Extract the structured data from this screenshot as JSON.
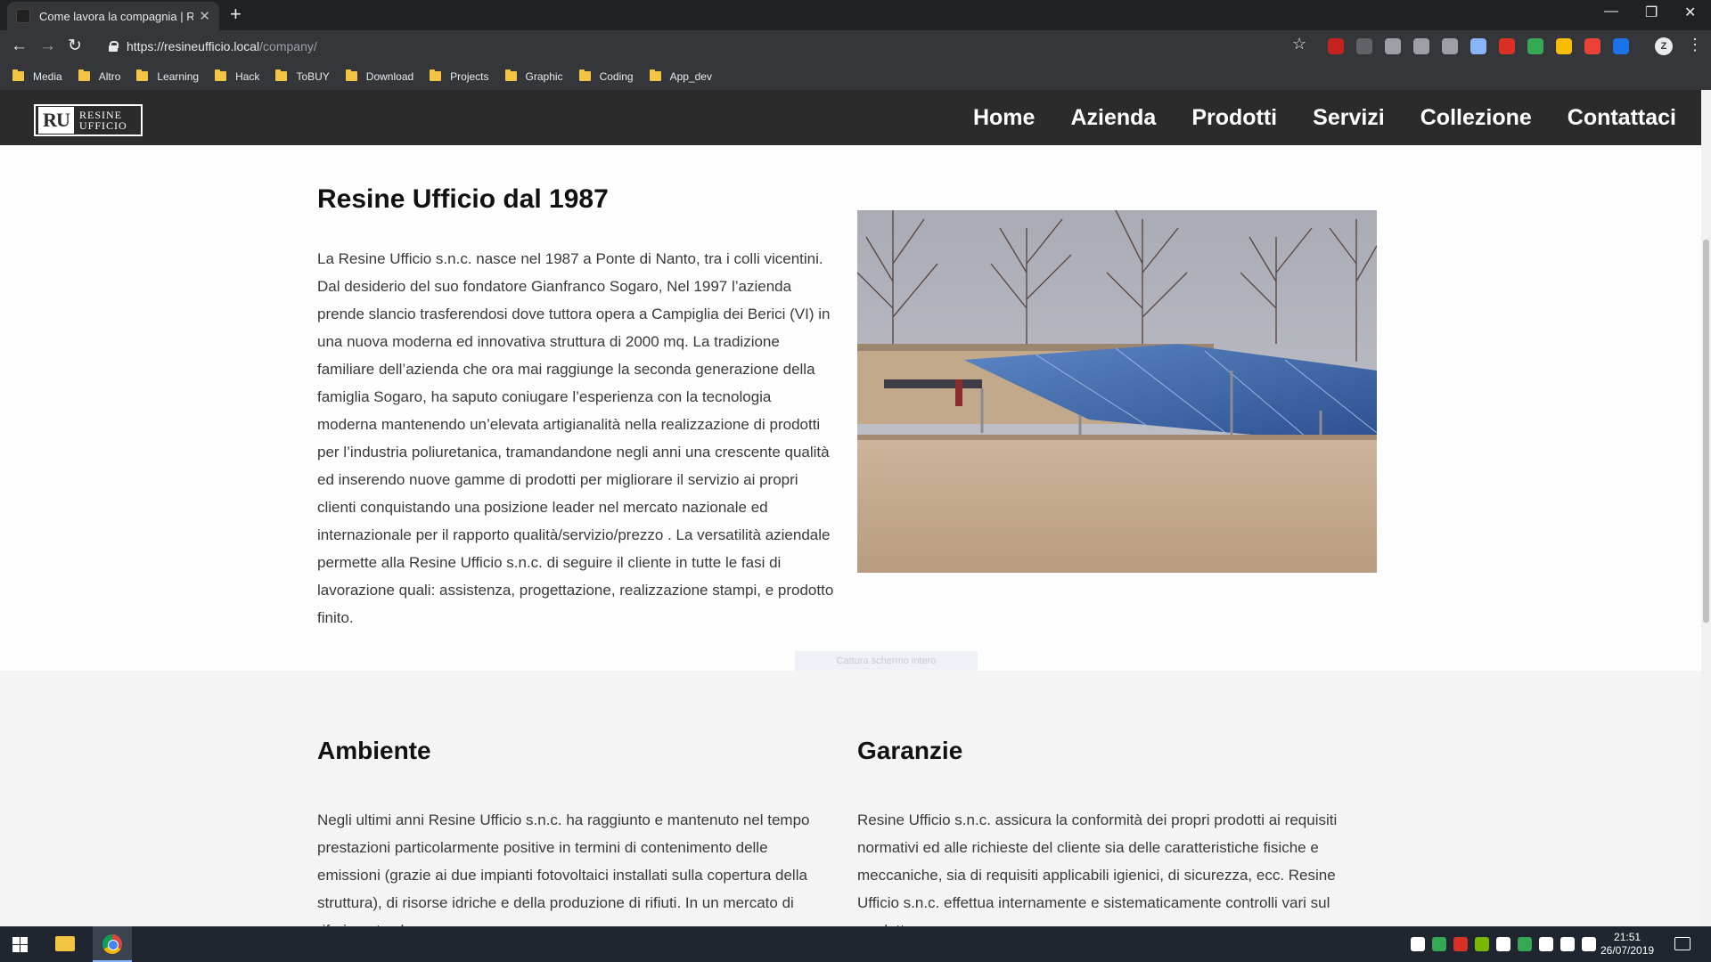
{
  "browser": {
    "tab_title": "Come lavora la compagnia | Resi",
    "tab_close": "✕",
    "new_tab": "+",
    "url_host": "https://resineufficio.local",
    "url_path": "/company/",
    "bookmarks": [
      "Media",
      "Altro",
      "Learning",
      "Hack",
      "ToBUY",
      "Download",
      "Projects",
      "Graphic",
      "Coding",
      "App_dev"
    ],
    "profile_initial": "Z",
    "extension_colors": [
      "#c5221f",
      "#5f6368",
      "#9aa0a6",
      "#9aa0a6",
      "#9aa0a6",
      "#8ab4f8",
      "#d93025",
      "#34a853",
      "#fbbc04",
      "#ea4335",
      "#1a73e8"
    ]
  },
  "site": {
    "logo_mark": "RU",
    "logo_text_line1": "RESINE",
    "logo_text_line2": "UFFICIO",
    "nav": [
      "Home",
      "Azienda",
      "Prodotti",
      "Servizi",
      "Collezione",
      "Contattaci"
    ]
  },
  "content": {
    "title": "Resine Ufficio dal 1987",
    "intro": "La Resine Ufficio s.n.c. nasce nel 1987 a Ponte di Nanto, tra i colli vicentini. Dal desiderio del suo fondatore Gianfranco Sogaro, Nel 1997 l’azienda prende slancio trasferendosi dove tuttora opera a Campiglia dei Berici (VI) in una nuova moderna ed innovativa struttura di 2000 mq. La tradizione familiare dell’azienda che ora mai raggiunge la seconda generazione della famiglia Sogaro, ha saputo coniugare l’esperienza con la tecnologia moderna mantenendo un’elevata artigianalità nella realizzazione di prodotti per l’industria poliuretanica, tramandandone negli anni una crescente qualità ed inserendo nuove gamme di prodotti per migliorare il servizio ai propri clienti conquistando una posizione leader nel mercato nazionale ed internazionale per il rapporto qualità/servizio/prezzo . La versatilità aziendale permette alla Resine Ufficio s.n.c. di seguire il cliente in tutte le fasi di lavorazione quali: assistenza, progettazione, realizzazione stampi, e prodotto finito.",
    "capture_hint": "Cattura schermo intero",
    "ambiente_title": "Ambiente",
    "ambiente_text": "Negli ultimi anni Resine Ufficio s.n.c. ha raggiunto e mantenuto nel tempo prestazioni particolarmente positive in termini di contenimento delle emissioni (grazie ai due impianti fotovoltaici installati sulla copertura della struttura), di risorse idriche e della produzione di rifiuti. In un mercato di riferimento che",
    "garanzie_title": "Garanzie",
    "garanzie_text": "Resine Ufficio s.n.c. assicura la conformità dei propri prodotti ai requisiti normativi ed alle richieste del cliente sia delle caratteristiche fisiche e meccaniche, sia di requisiti applicabili igienici, di sicurezza, ecc. Resine Ufficio s.n.c. effettua internamente e sistematicamente controlli vari sul prodotto,"
  },
  "taskbar": {
    "time": "21:51",
    "date": "26/07/2019",
    "tray_colors": [
      "#ffffff",
      "#34a853",
      "#d93025",
      "#76b900",
      "#ffffff",
      "#34a853",
      "#ffffff",
      "#ffffff",
      "#ffffff"
    ]
  }
}
